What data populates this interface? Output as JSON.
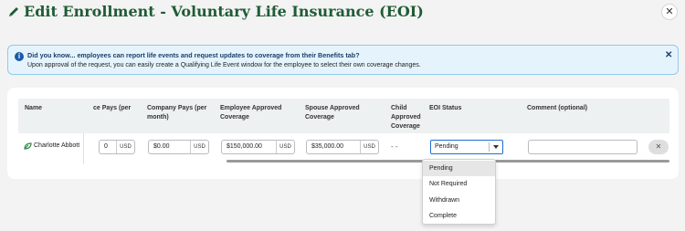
{
  "header": {
    "title": "Edit Enrollment - Voluntary Life Insurance (EOI)",
    "close_label": "✕"
  },
  "info_banner": {
    "title": "Did you know... employees can report life events and request updates to coverage from their Benefits tab?",
    "body": "Upon approval of the request, you can easily create a Qualifying Life Event window for the employee to select their own coverage changes.",
    "close_label": "✕"
  },
  "table": {
    "columns": {
      "name": "Name",
      "employee_pays_partial": "ce Pays (per",
      "company_pays": [
        "Company Pays (per",
        "month)"
      ],
      "employee_approved": [
        "Employee Approved",
        "Coverage"
      ],
      "spouse_approved": [
        "Spouse Approved",
        "Coverage"
      ],
      "child_approved": [
        "Child",
        "Approved",
        "Coverage"
      ],
      "eoi_status": "EOI Status",
      "comment": "Comment (optional)"
    },
    "row": {
      "name": "Charlotte Abbott",
      "employee_pays_value": "0",
      "employee_pays_unit": "USD",
      "company_pays_value": "$0.00",
      "company_pays_unit": "USD",
      "employee_approved_value": "$150,000.00",
      "employee_approved_unit": "USD",
      "spouse_approved_value": "$35,000.00",
      "spouse_approved_unit": "USD",
      "child_approved_value": "- -",
      "eoi_status": "Pending",
      "comment": "",
      "remove_label": "✕"
    }
  },
  "eoi_dropdown": {
    "options": [
      "Pending",
      "Not Required",
      "Withdrawn",
      "Complete"
    ],
    "highlighted_index": 0
  },
  "colors": {
    "title_green": "#1f5c35",
    "banner_bg": "#e5f4fc",
    "banner_border": "#8fcbea",
    "focus_blue": "#1e6fd0",
    "highlight": "#e6e6e6"
  }
}
